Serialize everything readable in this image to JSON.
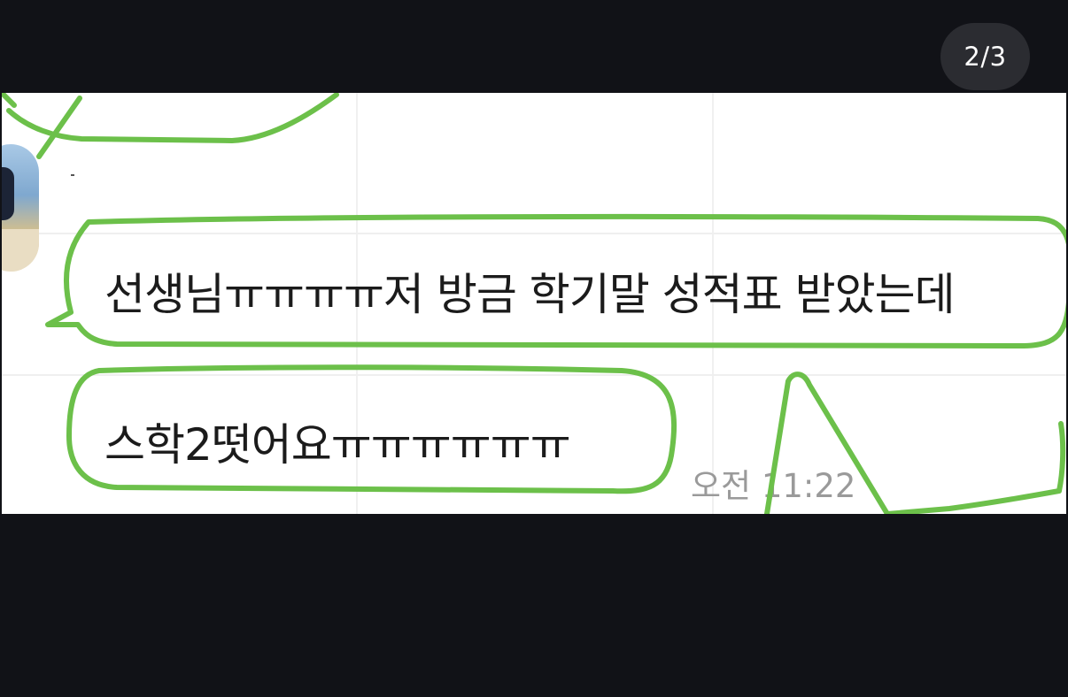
{
  "viewer": {
    "page_counter": "2/3"
  },
  "chat": {
    "messages": [
      {
        "text": "선생님ㅠㅠㅠㅠ저 방금 학기말 성적표 받았는데"
      },
      {
        "text": "스학2떳어요ㅠㅠㅠㅠㅠㅠ"
      }
    ],
    "timestamp": "오전 11:22"
  },
  "annotation": {
    "highlight_color": "#6cc04a"
  },
  "colors": {
    "background": "#111217",
    "photo_background": "#ffffff",
    "counter_pill": "#2b2c31"
  }
}
